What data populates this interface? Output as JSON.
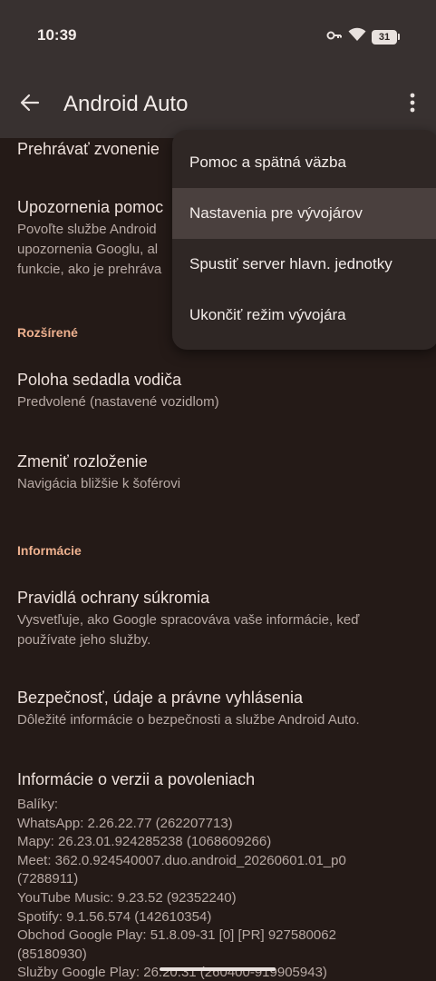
{
  "status_bar": {
    "time": "10:39",
    "battery": "31",
    "icons": [
      "key-icon",
      "wifi-icon",
      "battery-icon"
    ]
  },
  "app_bar": {
    "title": "Android Auto",
    "back_icon": "arrow-back-icon",
    "more_icon": "more-vert-icon"
  },
  "content": {
    "partial_item": {
      "title": "Prehrávať zvonenie"
    },
    "notifications_item": {
      "title": "Upozornenia pomoc",
      "subtitle_lines": [
        "Povoľte službe Android",
        "upozornenia Googlu, al",
        "funkcie, ako je prehráva"
      ]
    },
    "advanced_section": {
      "header": "Rozšírené",
      "items": [
        {
          "title": "Poloha sedadla vodiča",
          "subtitle": "Predvolené (nastavené vozidlom)"
        },
        {
          "title": "Zmeniť rozloženie",
          "subtitle": "Navigácia bližšie k šoférovi"
        }
      ]
    },
    "info_section": {
      "header": "Informácie",
      "items": [
        {
          "title": "Pravidlá ochrany súkromia",
          "subtitle": "Vysvetľuje, ako Google spracováva vaše informácie, keď používate jeho služby."
        },
        {
          "title": "Bezpečnosť, údaje a právne vyhlásenia",
          "subtitle": "Dôležité informácie o bezpečnosti a službe Android Auto."
        }
      ]
    },
    "version_item": {
      "title": "Informácie o verzii a povoleniach",
      "lines": [
        "Balíky:",
        "WhatsApp: 2.26.22.77 (262207713)",
        "Mapy: 26.23.01.924285238 (1068609266)",
        "Meet: 362.0.924540007.duo.android_20260601.01_p0",
        "(7288911)",
        "YouTube Music: 9.23.52 (92352240)",
        "Spotify: 9.1.56.574 (142610354)",
        "Obchod Google Play: 51.8.09-31 [0] [PR] 927580062",
        "(85180930)",
        "Služby Google Play: 26.20.31 (260400-919905943)"
      ]
    }
  },
  "menu": {
    "items": [
      {
        "label": "Pomoc a spätná väzba"
      },
      {
        "label": "Nastavenia pre vývojárov"
      },
      {
        "label": "Spustiť server hlavn. jednotky"
      },
      {
        "label": "Ukončiť režim vývojára"
      }
    ]
  },
  "colors": {
    "background": "#241a17",
    "app_bar": "#383130",
    "menu": "#2f2725",
    "menu_highlight": "#4a403e",
    "section_header": "#eeb18f",
    "primary_text": "#ede0db",
    "secondary_text": "#b8aaa5"
  }
}
